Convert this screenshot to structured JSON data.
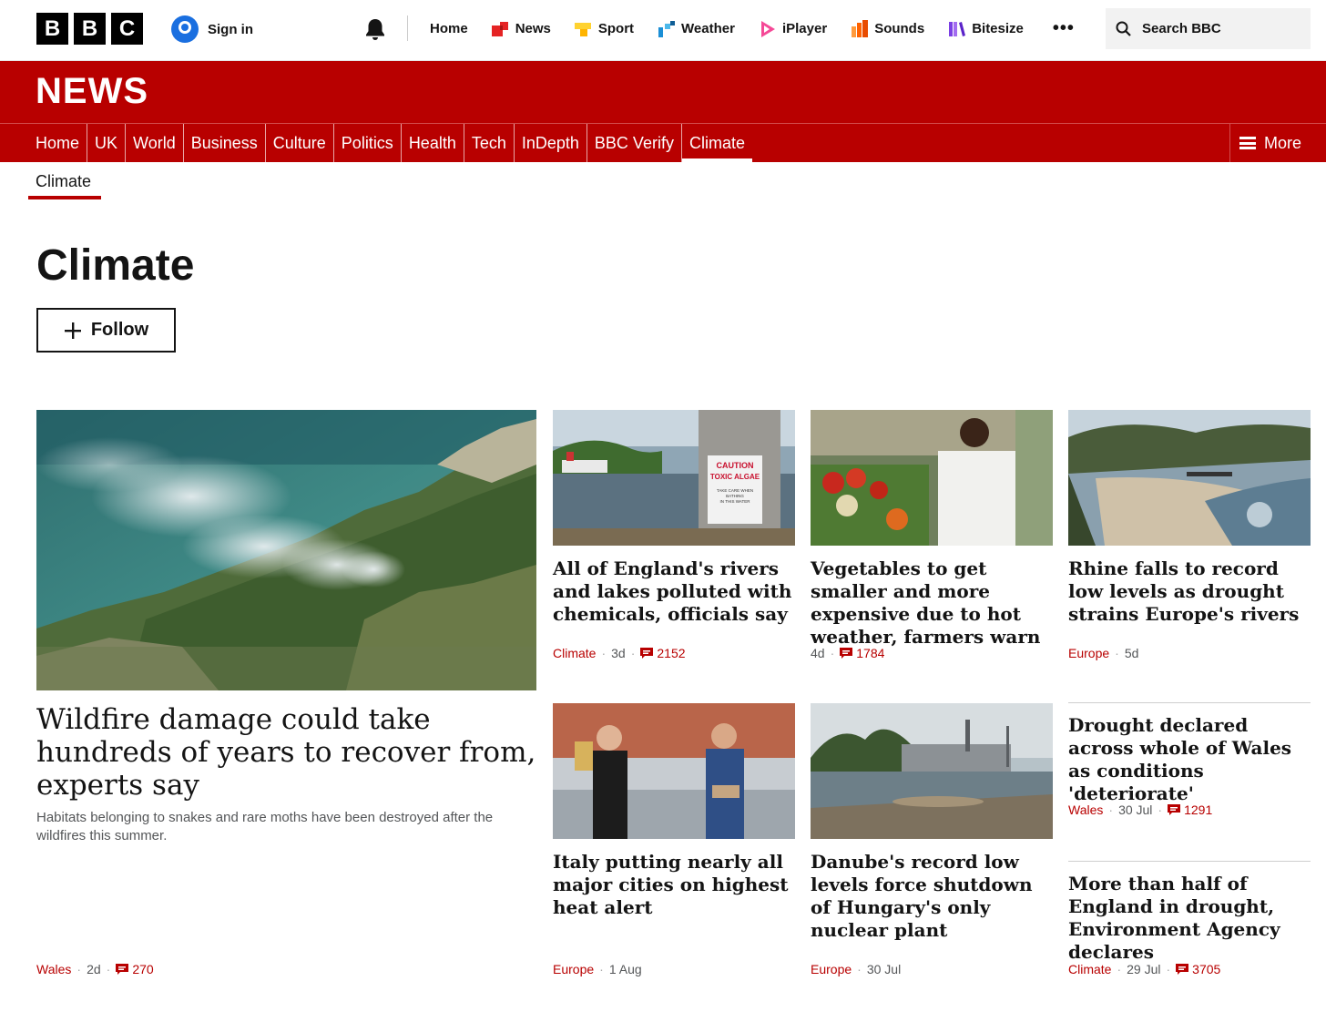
{
  "topbar": {
    "logo_letters": [
      "B",
      "B",
      "C"
    ],
    "sign_in": "Sign in",
    "nav": [
      {
        "label": "Home",
        "icon": "none"
      },
      {
        "label": "News",
        "icon": "news-icon",
        "color": "#e52324"
      },
      {
        "label": "Sport",
        "icon": "sport-icon",
        "color": "#ffd230"
      },
      {
        "label": "Weather",
        "icon": "weather-icon",
        "color": "#1b8fd6"
      },
      {
        "label": "iPlayer",
        "icon": "iplayer-icon",
        "color": "#f54997"
      },
      {
        "label": "Sounds",
        "icon": "sounds-icon",
        "color": "#ff6200"
      },
      {
        "label": "Bitesize",
        "icon": "bitesize-icon",
        "color": "#7b3fe4"
      }
    ],
    "more_label": "•••",
    "search_placeholder": "Search BBC"
  },
  "header": {
    "brand": "NEWS",
    "brand_color": "#b80000",
    "sections": [
      "Home",
      "UK",
      "World",
      "Business",
      "Culture",
      "Politics",
      "Health",
      "Tech",
      "InDepth",
      "BBC Verify",
      "Climate"
    ],
    "active_section": "Climate",
    "more_label": "More"
  },
  "subnav": {
    "label": "Climate"
  },
  "page": {
    "title": "Climate",
    "follow_label": "Follow"
  },
  "hero": {
    "title": "Wildfire damage could take hundreds of years to recover from, experts say",
    "summary": "Habitats belonging to snakes and rare moths have been destroyed after the wildfires this summer.",
    "tag": "Wales",
    "time": "2d",
    "comments": "270"
  },
  "stories": [
    {
      "title": "All of England's rivers and lakes polluted with chemicals, officials say",
      "tag": "Climate",
      "time": "3d",
      "comments": "2152",
      "image_sign": [
        "CAUTION",
        "TOXIC ALGAE",
        "TAKE CARE WHEN",
        "BATHING",
        "IN THIS WATER"
      ]
    },
    {
      "title": "Vegetables to get smaller and more expensive due to hot weather, farmers warn",
      "tag": "",
      "time": "4d",
      "comments": "1784"
    },
    {
      "title": "Rhine falls to record low levels as drought strains Europe's rivers",
      "tag": "Europe",
      "time": "5d",
      "comments": ""
    },
    {
      "title": "Italy putting nearly all major cities on highest heat alert",
      "tag": "Europe",
      "time": "1 Aug",
      "comments": ""
    },
    {
      "title": "Danube's record low levels force shutdown of Hungary's only nuclear plant",
      "tag": "Europe",
      "time": "30 Jul",
      "comments": ""
    },
    {
      "title": "Drought declared across whole of Wales as conditions 'deteriorate'",
      "tag": "Wales",
      "time": "30 Jul",
      "comments": "1291"
    },
    {
      "title": "More than half of England in drought, Environment Agency declares",
      "tag": "Climate",
      "time": "29 Jul",
      "comments": "3705"
    }
  ]
}
